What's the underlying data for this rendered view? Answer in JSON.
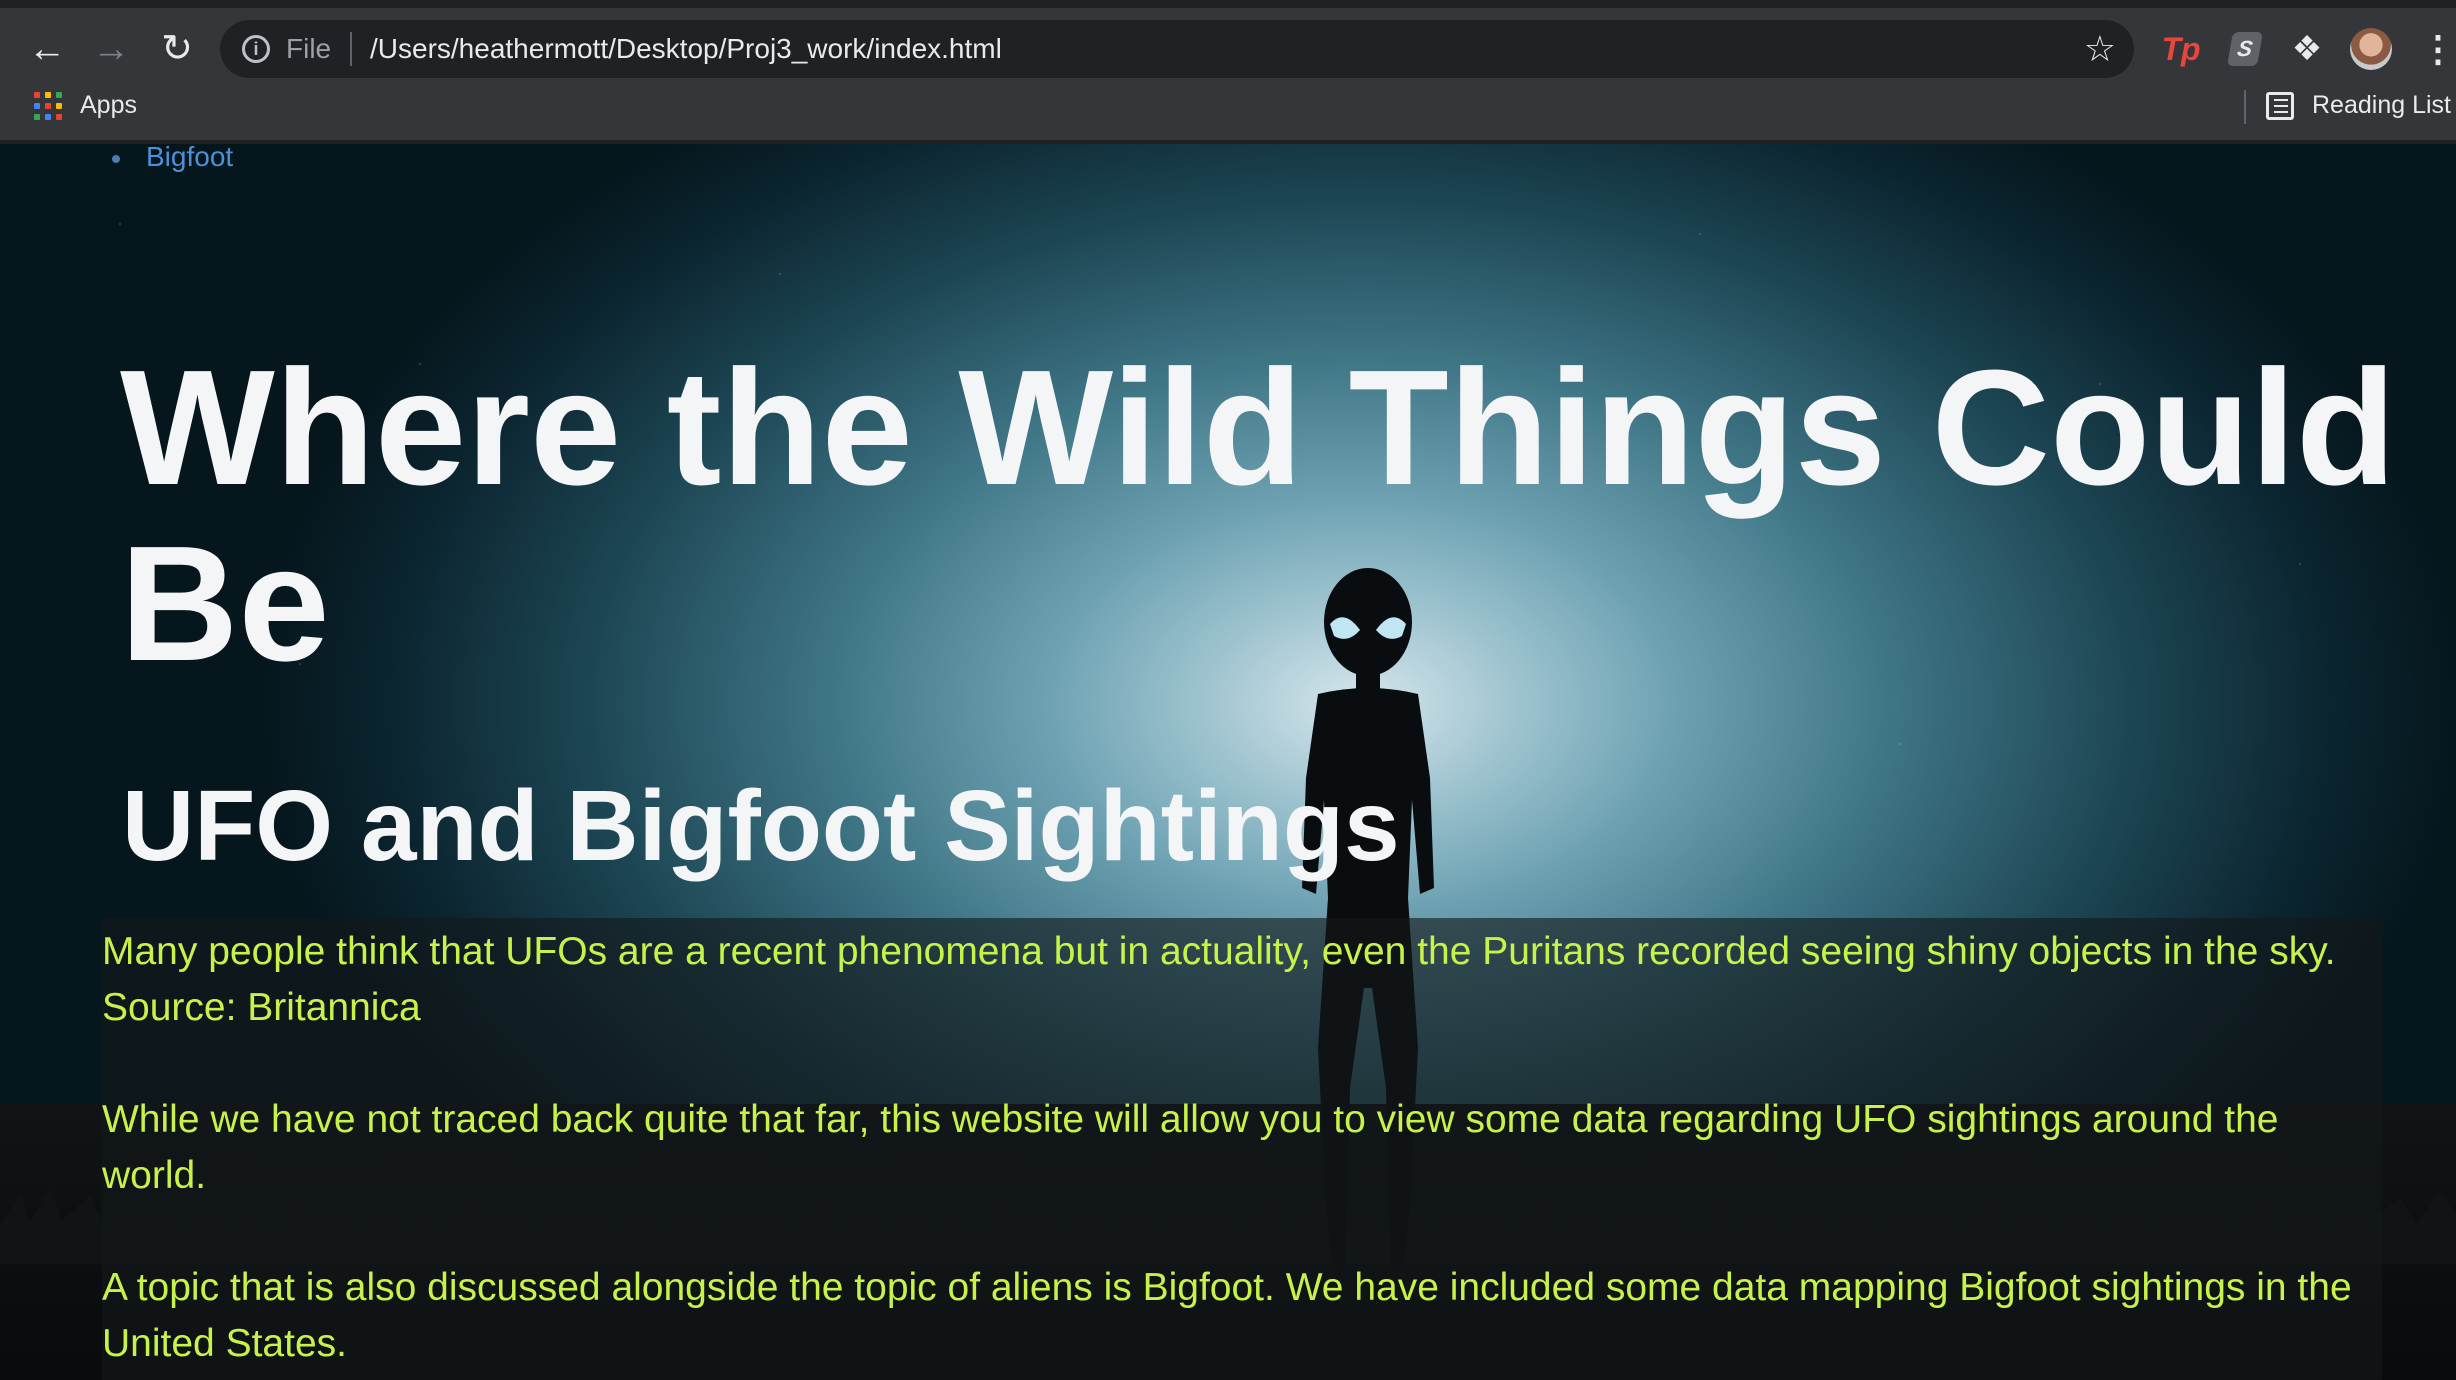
{
  "browser": {
    "scheme_label": "File",
    "url": "/Users/heathermott/Desktop/Proj3_work/index.html",
    "bookmarks": {
      "apps_label": "Apps",
      "reading_list_label": "Reading List"
    },
    "extensions": [
      "tp-extension-icon",
      "s-extension-icon",
      "puzzle-icon"
    ]
  },
  "page": {
    "nav": {
      "items": [
        {
          "label": "Bigfoot"
        }
      ]
    },
    "title": "Where the Wild Things Could Be",
    "subtitle": "UFO and Bigfoot Sightings",
    "paragraphs": [
      "Many people think that UFOs are a recent phenomena but in actuality, even the Puritans recorded seeing shiny objects in the sky. Source: Britannica",
      "While we have not traced back quite that far, this website will allow you to view some data regarding UFO sightings around the world.",
      "A topic that is also discussed alongside the topic of aliens is Bigfoot. We have included some data mapping Bigfoot sightings in the United States."
    ]
  },
  "colors": {
    "chrome_bg": "#35363a",
    "link": "#4d90d8",
    "heading": "#f4f5f6",
    "paragraph": "#c6f24a"
  }
}
